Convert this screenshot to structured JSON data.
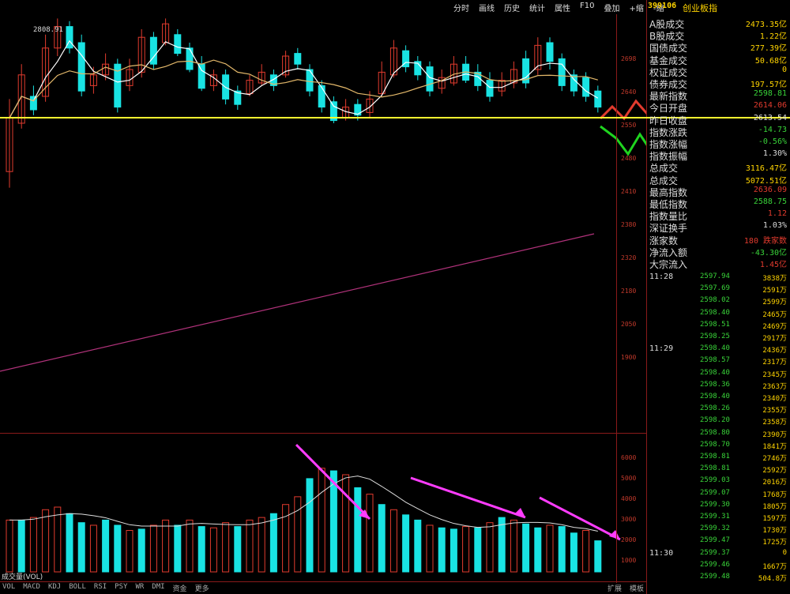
{
  "toolbar": [
    "分时",
    "画线",
    "历史",
    "统计",
    "属性",
    "F10",
    "叠加",
    "+缩",
    "-缩"
  ],
  "header": {
    "code": "399106",
    "name": "创业板指"
  },
  "chart": {
    "ohlc_label": "2808.91",
    "bottom_left": "成交量(VOL)",
    "tabs": [
      "VOL",
      "MACD",
      "KDJ",
      "BOLL",
      "RSI",
      "PSY",
      "WR",
      "DMI",
      "资金",
      "更多"
    ],
    "bottom_right": [
      "扩展",
      "模板"
    ],
    "price_labels": [
      "2698",
      "2640",
      "2550",
      "2480",
      "2410",
      "2380",
      "2320",
      "2180",
      "2050",
      "1900"
    ],
    "vol_labels": [
      "6000",
      "5000",
      "4000",
      "3000",
      "2000",
      "1000"
    ],
    "colors": {
      "up": "#e23b2e",
      "down": "#19e3e3",
      "ma5": "#ffffff",
      "ma10": "#e3b86a",
      "line": "#b0327a",
      "hline": "#ffff30",
      "arrow": "#ff3cff"
    }
  },
  "panel": {
    "rows": [
      {
        "label": "A股成交",
        "value": "2473.35亿",
        "color": "#ffd400"
      },
      {
        "label": "B股成交",
        "value": "1.22亿",
        "color": "#ffd400"
      },
      {
        "label": "国债成交",
        "value": "277.39亿",
        "color": "#ffd400"
      },
      {
        "label": "基金成交",
        "value": "50.68亿",
        "color": "#ffd400"
      },
      {
        "label": "权证成交",
        "value": "0",
        "color": "#ffd400"
      },
      {
        "label": "债券成交",
        "value": "197.57亿",
        "color": "#ffd400"
      },
      {
        "label": "最新指数",
        "value": "2598.81",
        "color": "#39d339"
      },
      {
        "label": "今日开盘",
        "value": "2614.06",
        "color": "#e23b2e"
      },
      {
        "label": "昨日收盘",
        "value": "2613.54",
        "color": "#ddd"
      },
      {
        "label": "指数涨跌",
        "value": "-14.73",
        "color": "#39d339"
      },
      {
        "label": "指数涨幅",
        "value": "-0.56%",
        "color": "#39d339"
      },
      {
        "label": "指数振幅",
        "value": "1.30%",
        "color": "#ddd"
      },
      {
        "label": "总成交",
        "value": "3116.47亿",
        "color": "#ffd400"
      },
      {
        "label": "总成交",
        "value": "5072.51亿",
        "color": "#ffd400"
      },
      {
        "label": "最高指数",
        "value": "2636.09",
        "color": "#e23b2e"
      },
      {
        "label": "最低指数",
        "value": "2588.75",
        "color": "#39d339"
      },
      {
        "label": "指数量比",
        "value": "1.12",
        "color": "#e23b2e"
      },
      {
        "label": "深证换手",
        "value": "1.03%",
        "color": "#ddd"
      },
      {
        "label": "涨家数",
        "value": "180 跌家数",
        "color": "#e23b2e"
      },
      {
        "label": "净流入额",
        "value": "-43.30亿",
        "color": "#39d339"
      },
      {
        "label": "大宗流入",
        "value": "1.45亿",
        "color": "#e23b2e"
      }
    ],
    "ticks": [
      {
        "t": "11:28",
        "p": "2597.94",
        "v": "3838万"
      },
      {
        "p": "2597.69",
        "v": "2591万"
      },
      {
        "p": "2598.02",
        "v": "2599万"
      },
      {
        "p": "2598.40",
        "v": "2465万"
      },
      {
        "p": "2598.51",
        "v": "2469万"
      },
      {
        "p": "2598.25",
        "v": "2917万"
      },
      {
        "t": "11:29",
        "p": "2598.40",
        "v": "2436万"
      },
      {
        "p": "2598.57",
        "v": "2317万"
      },
      {
        "p": "2598.40",
        "v": "2345万"
      },
      {
        "p": "2598.36",
        "v": "2363万"
      },
      {
        "p": "2598.40",
        "v": "2340万"
      },
      {
        "p": "2598.26",
        "v": "2355万"
      },
      {
        "p": "2598.20",
        "v": "2358万"
      },
      {
        "p": "2598.80",
        "v": "2390万"
      },
      {
        "p": "2598.70",
        "v": "1841万"
      },
      {
        "p": "2598.81",
        "v": "2746万"
      },
      {
        "p": "2598.81",
        "v": "2592万"
      },
      {
        "p": "2599.03",
        "v": "2016万"
      },
      {
        "p": "2599.07",
        "v": "1768万"
      },
      {
        "p": "2599.30",
        "v": "1805万"
      },
      {
        "p": "2599.31",
        "v": "1597万"
      },
      {
        "p": "2599.32",
        "v": "1730万"
      },
      {
        "p": "2599.47",
        "v": "1725万"
      },
      {
        "t": "11:30",
        "p": "2599.37",
        "v": "0"
      },
      {
        "p": "2599.46",
        "v": "1667万"
      },
      {
        "p": "2599.48",
        "v": "504.8万"
      }
    ]
  },
  "candles": [
    [
      1,
      0.62,
      0.42,
      0.69,
      0.36
    ],
    [
      1,
      0.78,
      0.6,
      0.82,
      0.58
    ],
    [
      0,
      0.7,
      0.65,
      0.74,
      0.63
    ],
    [
      1,
      0.88,
      0.7,
      0.93,
      0.68
    ],
    [
      1,
      0.96,
      0.88,
      0.99,
      0.85
    ],
    [
      0,
      0.96,
      0.88,
      0.98,
      0.86
    ],
    [
      0,
      0.9,
      0.72,
      0.93,
      0.7
    ],
    [
      1,
      0.78,
      0.74,
      0.81,
      0.71
    ],
    [
      1,
      0.82,
      0.78,
      0.86,
      0.76
    ],
    [
      0,
      0.82,
      0.66,
      0.84,
      0.64
    ],
    [
      1,
      0.8,
      0.74,
      0.84,
      0.72
    ],
    [
      1,
      0.92,
      0.79,
      0.95,
      0.77
    ],
    [
      0,
      0.92,
      0.82,
      0.94,
      0.8
    ],
    [
      1,
      0.97,
      0.9,
      0.99,
      0.89
    ],
    [
      0,
      0.93,
      0.86,
      0.95,
      0.85
    ],
    [
      0,
      0.88,
      0.8,
      0.9,
      0.79
    ],
    [
      0,
      0.82,
      0.73,
      0.85,
      0.72
    ],
    [
      1,
      0.78,
      0.74,
      0.8,
      0.72
    ],
    [
      0,
      0.78,
      0.69,
      0.8,
      0.67
    ],
    [
      0,
      0.72,
      0.67,
      0.74,
      0.65
    ],
    [
      1,
      0.76,
      0.71,
      0.78,
      0.7
    ],
    [
      1,
      0.79,
      0.75,
      0.82,
      0.74
    ],
    [
      0,
      0.78,
      0.74,
      0.8,
      0.72
    ],
    [
      1,
      0.85,
      0.78,
      0.87,
      0.77
    ],
    [
      0,
      0.86,
      0.82,
      0.88,
      0.8
    ],
    [
      0,
      0.8,
      0.72,
      0.82,
      0.7
    ],
    [
      0,
      0.74,
      0.66,
      0.76,
      0.64
    ],
    [
      0,
      0.68,
      0.61,
      0.7,
      0.6
    ],
    [
      1,
      0.66,
      0.62,
      0.69,
      0.61
    ],
    [
      0,
      0.67,
      0.63,
      0.69,
      0.61
    ],
    [
      1,
      0.69,
      0.64,
      0.72,
      0.62
    ],
    [
      1,
      0.79,
      0.71,
      0.83,
      0.7
    ],
    [
      1,
      0.88,
      0.78,
      0.91,
      0.77
    ],
    [
      0,
      0.87,
      0.81,
      0.89,
      0.79
    ],
    [
      0,
      0.83,
      0.78,
      0.85,
      0.76
    ],
    [
      0,
      0.81,
      0.72,
      0.83,
      0.7
    ],
    [
      1,
      0.77,
      0.73,
      0.8,
      0.71
    ],
    [
      1,
      0.82,
      0.75,
      0.85,
      0.74
    ],
    [
      0,
      0.82,
      0.76,
      0.85,
      0.75
    ],
    [
      0,
      0.79,
      0.74,
      0.82,
      0.72
    ],
    [
      0,
      0.76,
      0.7,
      0.79,
      0.68
    ],
    [
      1,
      0.76,
      0.72,
      0.79,
      0.7
    ],
    [
      1,
      0.8,
      0.75,
      0.83,
      0.73
    ],
    [
      0,
      0.84,
      0.75,
      0.87,
      0.73
    ],
    [
      1,
      0.89,
      0.8,
      0.92,
      0.78
    ],
    [
      0,
      0.9,
      0.83,
      0.92,
      0.8
    ],
    [
      0,
      0.84,
      0.74,
      0.86,
      0.72
    ],
    [
      0,
      0.78,
      0.72,
      0.8,
      0.7
    ],
    [
      0,
      0.77,
      0.7,
      0.79,
      0.68
    ],
    [
      0,
      0.72,
      0.66,
      0.74,
      0.64
    ]
  ],
  "volumes": [
    [
      1,
      0.4
    ],
    [
      0,
      0.4
    ],
    [
      1,
      0.42
    ],
    [
      1,
      0.48
    ],
    [
      1,
      0.5
    ],
    [
      0,
      0.45
    ],
    [
      0,
      0.38
    ],
    [
      1,
      0.36
    ],
    [
      0,
      0.4
    ],
    [
      0,
      0.36
    ],
    [
      1,
      0.32
    ],
    [
      0,
      0.33
    ],
    [
      1,
      0.36
    ],
    [
      1,
      0.4
    ],
    [
      0,
      0.36
    ],
    [
      1,
      0.4
    ],
    [
      0,
      0.35
    ],
    [
      1,
      0.34
    ],
    [
      1,
      0.38
    ],
    [
      0,
      0.35
    ],
    [
      1,
      0.4
    ],
    [
      1,
      0.42
    ],
    [
      0,
      0.45
    ],
    [
      1,
      0.52
    ],
    [
      1,
      0.58
    ],
    [
      0,
      0.72
    ],
    [
      1,
      0.8
    ],
    [
      0,
      0.78
    ],
    [
      1,
      0.75
    ],
    [
      0,
      0.65
    ],
    [
      1,
      0.6
    ],
    [
      0,
      0.52
    ],
    [
      1,
      0.48
    ],
    [
      0,
      0.44
    ],
    [
      0,
      0.4
    ],
    [
      1,
      0.36
    ],
    [
      0,
      0.34
    ],
    [
      0,
      0.33
    ],
    [
      1,
      0.35
    ],
    [
      0,
      0.34
    ],
    [
      1,
      0.38
    ],
    [
      0,
      0.42
    ],
    [
      1,
      0.4
    ],
    [
      0,
      0.37
    ],
    [
      0,
      0.34
    ],
    [
      1,
      0.36
    ],
    [
      0,
      0.35
    ],
    [
      0,
      0.3
    ],
    [
      1,
      0.32
    ],
    [
      0,
      0.24
    ]
  ]
}
